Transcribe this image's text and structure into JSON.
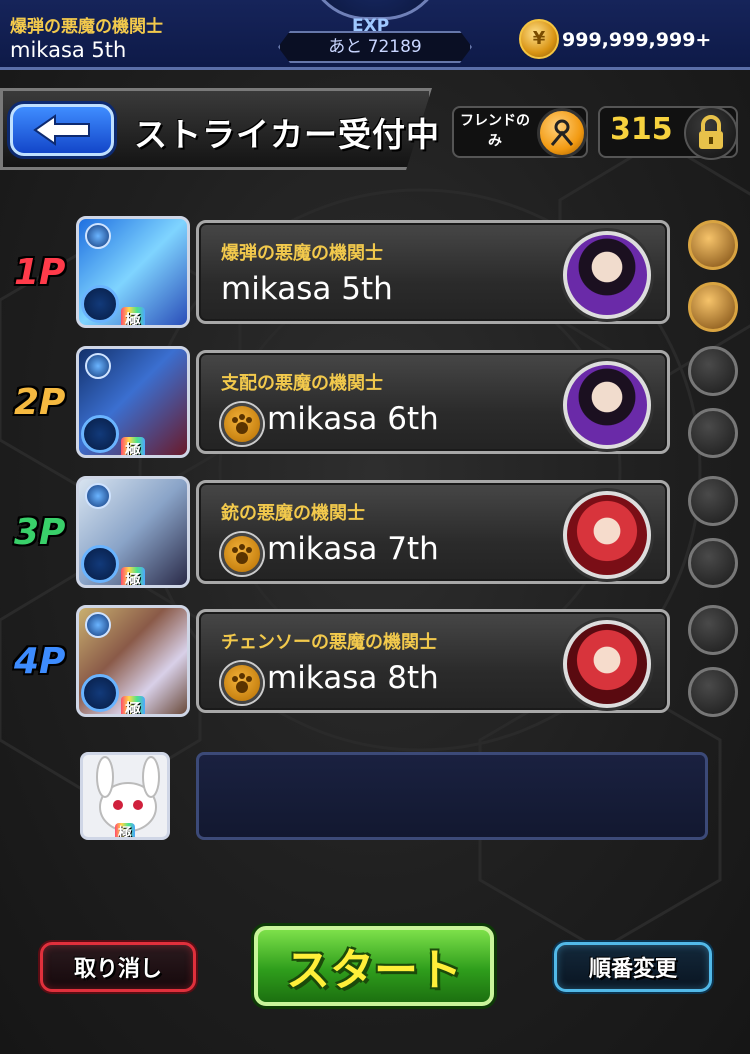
{
  "header": {
    "quest_title": "爆弾の悪魔の機関士",
    "player_name": "mikasa 5th",
    "exp_label": "EXP",
    "exp_remaining": "あと 72189",
    "coins": "999,999,999+"
  },
  "title_bar": {
    "title": "ストライカー受付中",
    "friend_only_label": "フレンドのみ",
    "stamina": "315"
  },
  "players": [
    {
      "label": "1P",
      "label_color": "#ff3b4a",
      "title": "爆弾の悪魔の機関士",
      "name": "mikasa 5th",
      "friend_icon": false,
      "rank": "極"
    },
    {
      "label": "2P",
      "label_color": "#f5b940",
      "title": "支配の悪魔の機関士",
      "name": "mikasa 6th",
      "friend_icon": true,
      "rank": "極"
    },
    {
      "label": "3P",
      "label_color": "#39d06a",
      "title": "銃の悪魔の機関士",
      "name": "mikasa 7th",
      "friend_icon": true,
      "rank": "極"
    },
    {
      "label": "4P",
      "label_color": "#3d8cff",
      "title": "チェンソーの悪魔の機関士",
      "name": "mikasa 8th",
      "friend_icon": true,
      "rank": "極"
    }
  ],
  "helper": {
    "rank": "極"
  },
  "buttons": {
    "cancel": "取り消し",
    "start": "スタート",
    "change_order": "順番変更"
  },
  "colors": {
    "accent_gold": "#f2c94c",
    "start_green": "#2f9e1c",
    "cancel_red": "#e0303c",
    "order_blue": "#52b9e8"
  }
}
